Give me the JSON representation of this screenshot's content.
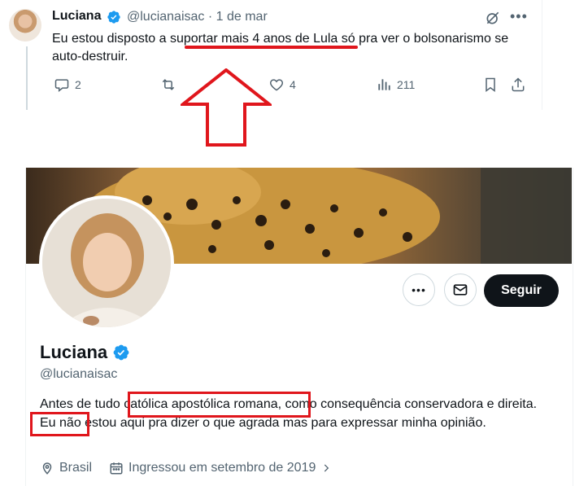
{
  "tweet": {
    "name": "Luciana",
    "handle": "@lucianaisac",
    "date": "1 de mar",
    "text_before": "Eu estou disposto a ",
    "text_highlight": "suportar mais 4 anos de Lula",
    "text_after": " só pra ver o bolsonarismo se auto-destruir.",
    "actions": {
      "replies": "2",
      "likes": "4",
      "views": "211"
    }
  },
  "profile": {
    "name": "Luciana",
    "handle": "@lucianaisac",
    "bio_part1": "Antes de tudo ",
    "bio_highlight1": "católica apostólica romana",
    "bio_part2": ", como consequência conservadora e ",
    "bio_highlight2": "direita",
    "bio_part3": ". Eu não estou aqui pra dizer o que agrada mas para expressar minha opinião.",
    "location": "Brasil",
    "joined": "Ingressou em setembro de 2019",
    "follow_label": "Seguir"
  },
  "colors": {
    "annotation": "#e0161c",
    "verified": "#1d9bf0",
    "muted": "#536471"
  },
  "icons": [
    "verified-badge-icon",
    "grok-icon",
    "more-icon",
    "reply-icon",
    "retweet-icon",
    "like-icon",
    "views-icon",
    "bookmark-icon",
    "share-icon",
    "message-icon",
    "location-icon",
    "calendar-icon",
    "chevron-right-icon"
  ]
}
